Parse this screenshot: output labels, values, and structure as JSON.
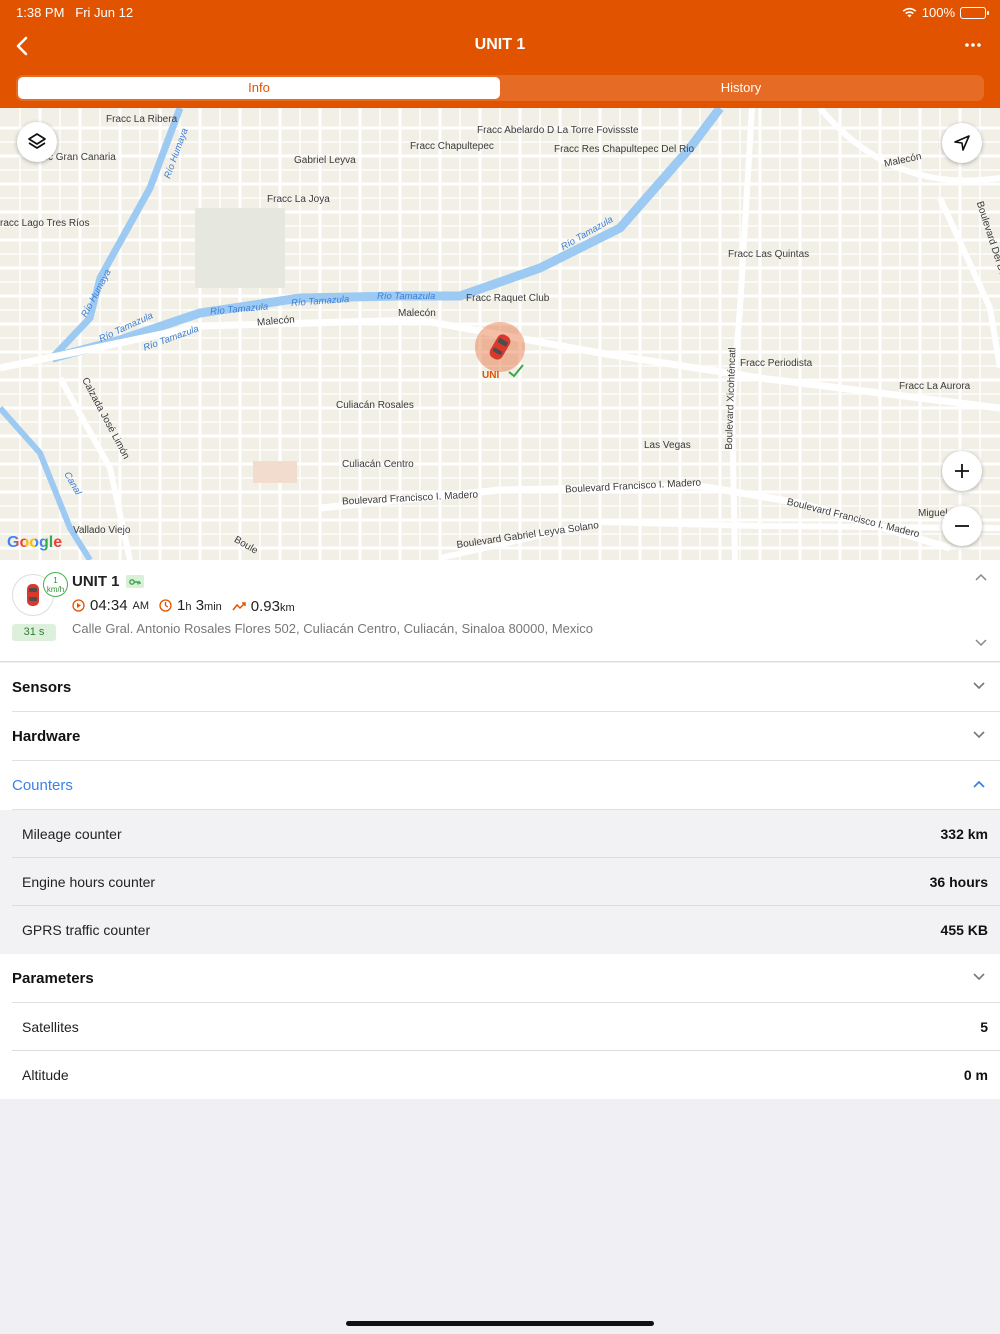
{
  "status_bar": {
    "time": "1:38 PM",
    "date": "Fri Jun 12",
    "battery": "100%"
  },
  "nav": {
    "title": "UNIT 1"
  },
  "tabs": [
    {
      "label": "Info",
      "active": true
    },
    {
      "label": "History",
      "active": false
    }
  ],
  "map": {
    "labels": [
      "Fracc La Ribera",
      "cc Gran Canaria",
      "Fracc Abelardo D La Torre Fovissste",
      "Fracc Chapultepec",
      "Fracc Res Chapultepec Del Rio",
      "Gabriel Leyva",
      "Fracc La Joya",
      "racc Lago Tres Ríos",
      "Fracc Las Quintas",
      "Malecón",
      "Malecón",
      "Fracc Raquet Club",
      "Malecón",
      "Fracc Periodista",
      "Fracc La Aurora",
      "Culiacán Rosales",
      "Las Vegas",
      "Culiacán Centro",
      "Boulevard Francisco I. Madero",
      "Boulevard Francisco I. Madero",
      "Boulevard Francisco I. Madero",
      "Vallado Viejo",
      "Boulevard Gabriel Leyva Solano",
      "Calzada José Limón",
      "Boulevard Xicohténcatl",
      "Boulevard Del Dorado",
      "Miguel",
      "Boule"
    ],
    "river_labels": [
      "Río Humaya",
      "Río Humaya",
      "Río Tamazula",
      "Río Tamazula",
      "Río Tamazula",
      "Río Tamazula",
      "Río Tamazula",
      "Río Tamazula",
      "Canal"
    ],
    "marker_label": "UNI",
    "google": "Google",
    "colors": {
      "land": "#f1efe6",
      "road": "#ffffff",
      "river": "#9ccaf3"
    }
  },
  "unit": {
    "name": "UNIT 1",
    "speed_value": "1",
    "speed_unit": "km/h",
    "age": "31 s",
    "time_value": "04:34",
    "time_suffix": "AM",
    "duration_h": "1",
    "duration_h_unit": "h",
    "duration_m": "3",
    "duration_m_unit": "min",
    "distance_value": "0.93",
    "distance_unit": "km",
    "address": "Calle Gral. Antonio Rosales Flores 502, Culiacán Centro, Culiacán, Sinaloa 80000, Mexico"
  },
  "sections": {
    "sensors": "Sensors",
    "hardware": "Hardware",
    "counters": "Counters",
    "counters_rows": [
      {
        "label": "Mileage counter",
        "value": "332 km"
      },
      {
        "label": "Engine hours counter",
        "value": "36 hours"
      },
      {
        "label": "GPRS traffic counter",
        "value": "455 KB"
      }
    ],
    "parameters": "Parameters",
    "parameters_rows": [
      {
        "label": "Satellites",
        "value": "5"
      },
      {
        "label": "Altitude",
        "value": "0 m"
      }
    ]
  },
  "theme": {
    "accent": "#e25300",
    "link": "#3b82e8",
    "ok": "#47b04b"
  }
}
